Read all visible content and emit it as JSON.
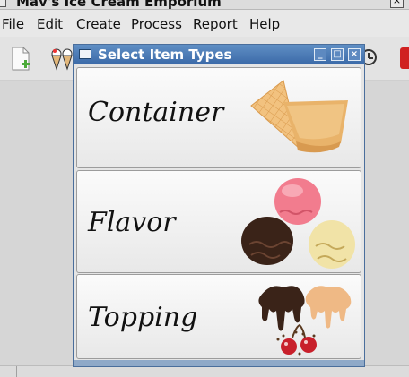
{
  "app": {
    "title": "Mav's Ice Cream Emporium",
    "close_glyph": "×"
  },
  "menu": [
    "File",
    "Edit",
    "Create",
    "Process",
    "Report",
    "Help"
  ],
  "dialog": {
    "title": "Select Item Types",
    "buttons": [
      "_",
      "□",
      "×"
    ],
    "items": [
      {
        "label": "Container",
        "icon": "waffle-cone-cup-icon"
      },
      {
        "label": "Flavor",
        "icon": "ice-cream-scoops-icon"
      },
      {
        "label": "Topping",
        "icon": "chocolate-caramel-cherries-icon"
      }
    ]
  },
  "colors": {
    "dialog_title_bg": "#3b6aa8",
    "cone": "#e9b36a",
    "strawberry": "#f27c8e",
    "chocolate": "#3a2318",
    "vanilla": "#f1e3a7",
    "caramel": "#efb985",
    "cherry": "#c8202b"
  }
}
